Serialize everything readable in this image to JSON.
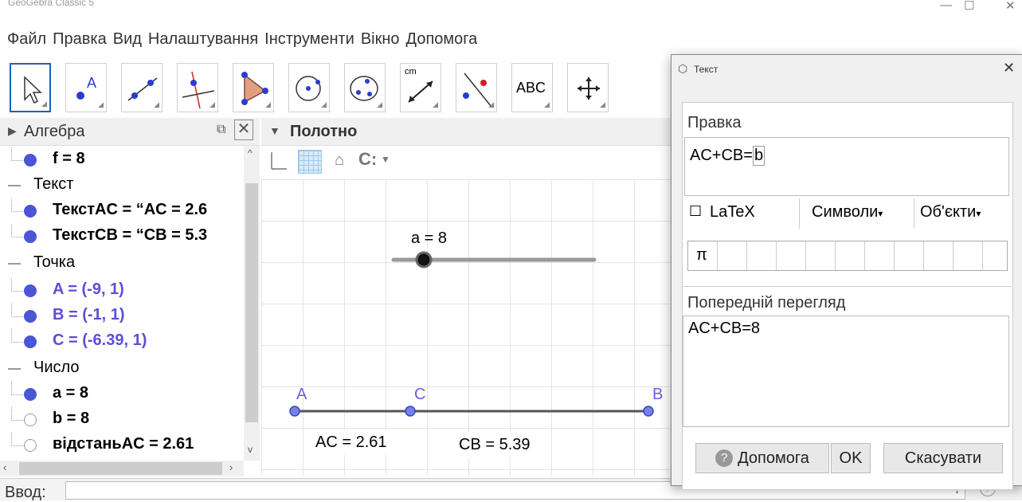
{
  "app": {
    "title": "GeoGebra Classic 5"
  },
  "window_controls": {
    "minimize": "—",
    "maximize": "☐",
    "close": "✕"
  },
  "menu": [
    "Файл",
    "Правка",
    "Вид",
    "Налаштування",
    "Інструменти",
    "Вікно",
    "Допомога"
  ],
  "toolbar": {
    "tools": [
      "move-tool",
      "point-tool",
      "line-tool",
      "perpendicular-line-tool",
      "polygon-tool",
      "circle-tool",
      "conic-tool",
      "measure-tool",
      "reflect-tool",
      "text-tool",
      "move-graphics-tool"
    ],
    "measure_label": "cm",
    "text_label": "ABC"
  },
  "algebra": {
    "title": "Алгебра",
    "rows": [
      {
        "kind": "item",
        "text": "f = 8",
        "color": "blue",
        "style": "bold"
      },
      {
        "kind": "category",
        "text": "Текст"
      },
      {
        "kind": "item",
        "text": "ТекстAC = “AC = 2.6",
        "style": "bold"
      },
      {
        "kind": "item",
        "text": "ТекстCB = “CB = 5.3",
        "style": "bold"
      },
      {
        "kind": "category",
        "text": "Точка"
      },
      {
        "kind": "item",
        "text": "A = (-9, 1)",
        "color": "blue",
        "style": "bold"
      },
      {
        "kind": "item",
        "text": "B = (-1, 1)",
        "color": "blue",
        "style": "bold"
      },
      {
        "kind": "item",
        "text": "C = (-6.39, 1)",
        "color": "blue",
        "style": "bold"
      },
      {
        "kind": "category",
        "text": "Число"
      },
      {
        "kind": "item",
        "text": "a = 8",
        "style": "bold"
      },
      {
        "kind": "item",
        "text": "b = 8",
        "style": "bold",
        "hollow": true
      },
      {
        "kind": "item",
        "text": "відстаньAC = 2.61",
        "style": "bold",
        "hollow": true
      }
    ]
  },
  "graphics": {
    "title": "Полотно",
    "slider_label": "a = 8",
    "points": {
      "A": "A",
      "B": "B",
      "C": "C"
    },
    "ac_text": "AC = 2.61",
    "cb_text": "CB = 5.39"
  },
  "input_bar": {
    "label": "Ввод:",
    "value": ""
  },
  "dialog": {
    "title": "Текст",
    "close": "✕",
    "edit_label": "Правка",
    "edit_text": "AC+CB=",
    "edit_object": "b",
    "latex_checkbox": "☐",
    "latex_label": "LaTeX",
    "symbols_label": "Символи",
    "objects_label": "Об'єкти",
    "dropdown_caret": "▾",
    "pi_symbol": "π",
    "preview_label": "Попередній перегляд",
    "preview_text": "AC+CB=8",
    "help_button": "Допомога",
    "ok_button": "OK",
    "cancel_button": "Скасувати"
  },
  "colors": {
    "point": "#4a55d8",
    "point_label": "#6a5fe0",
    "selected_tool_border": "#1f61b5"
  }
}
